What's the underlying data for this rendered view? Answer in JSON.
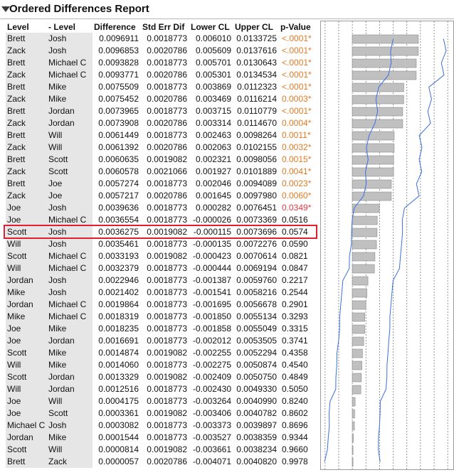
{
  "report": {
    "title": "Ordered Differences Report"
  },
  "columns": [
    "Level",
    "- Level",
    "Difference",
    "Std Err Dif",
    "Lower CL",
    "Upper CL",
    "p-Value"
  ],
  "colors": {
    "sig_orange": "#e07a22",
    "sig_red": "#e23a4c",
    "bar": "#c0c0c0",
    "ci_line": "#3a6fe0",
    "highlight": "#e02030"
  },
  "highlighted_row": 18,
  "rows": [
    {
      "level": "Brett",
      "minus": "Josh",
      "diff": "0.0096911",
      "se": "0.0018773",
      "lcl": "0.006010",
      "ucl": "0.0133725",
      "p": "<.0001*",
      "sig": "orange"
    },
    {
      "level": "Zack",
      "minus": "Josh",
      "diff": "0.0096853",
      "se": "0.0020786",
      "lcl": "0.005609",
      "ucl": "0.0137616",
      "p": "<.0001*",
      "sig": "orange"
    },
    {
      "level": "Brett",
      "minus": "Michael C",
      "diff": "0.0093828",
      "se": "0.0018773",
      "lcl": "0.005701",
      "ucl": "0.0130643",
      "p": "<.0001*",
      "sig": "orange"
    },
    {
      "level": "Zack",
      "minus": "Michael C",
      "diff": "0.0093771",
      "se": "0.0020786",
      "lcl": "0.005301",
      "ucl": "0.0134534",
      "p": "<.0001*",
      "sig": "orange"
    },
    {
      "level": "Brett",
      "minus": "Mike",
      "diff": "0.0075509",
      "se": "0.0018773",
      "lcl": "0.003869",
      "ucl": "0.0112323",
      "p": "<.0001*",
      "sig": "orange"
    },
    {
      "level": "Zack",
      "minus": "Mike",
      "diff": "0.0075452",
      "se": "0.0020786",
      "lcl": "0.003469",
      "ucl": "0.0116214",
      "p": "0.0003*",
      "sig": "orange"
    },
    {
      "level": "Brett",
      "minus": "Jordan",
      "diff": "0.0073965",
      "se": "0.0018773",
      "lcl": "0.003715",
      "ucl": "0.0110779",
      "p": "<.0001*",
      "sig": "orange"
    },
    {
      "level": "Zack",
      "minus": "Jordan",
      "diff": "0.0073908",
      "se": "0.0020786",
      "lcl": "0.003314",
      "ucl": "0.0114670",
      "p": "0.0004*",
      "sig": "orange"
    },
    {
      "level": "Brett",
      "minus": "Will",
      "diff": "0.0061449",
      "se": "0.0018773",
      "lcl": "0.002463",
      "ucl": "0.0098264",
      "p": "0.0011*",
      "sig": "orange"
    },
    {
      "level": "Zack",
      "minus": "Will",
      "diff": "0.0061392",
      "se": "0.0020786",
      "lcl": "0.002063",
      "ucl": "0.0102155",
      "p": "0.0032*",
      "sig": "orange"
    },
    {
      "level": "Brett",
      "minus": "Scott",
      "diff": "0.0060635",
      "se": "0.0019082",
      "lcl": "0.002321",
      "ucl": "0.0098056",
      "p": "0.0015*",
      "sig": "orange"
    },
    {
      "level": "Zack",
      "minus": "Scott",
      "diff": "0.0060578",
      "se": "0.0021066",
      "lcl": "0.001927",
      "ucl": "0.0101889",
      "p": "0.0041*",
      "sig": "orange"
    },
    {
      "level": "Brett",
      "minus": "Joe",
      "diff": "0.0057274",
      "se": "0.0018773",
      "lcl": "0.002046",
      "ucl": "0.0094089",
      "p": "0.0023*",
      "sig": "orange"
    },
    {
      "level": "Zack",
      "minus": "Joe",
      "diff": "0.0057217",
      "se": "0.0020786",
      "lcl": "0.001645",
      "ucl": "0.0097980",
      "p": "0.0060*",
      "sig": "orange"
    },
    {
      "level": "Joe",
      "minus": "Josh",
      "diff": "0.0039636",
      "se": "0.0018773",
      "lcl": "0.000282",
      "ucl": "0.0076451",
      "p": "0.0349*",
      "sig": "red"
    },
    {
      "level": "Joe",
      "minus": "Michael C",
      "diff": "0.0036554",
      "se": "0.0018773",
      "lcl": "-0.000026",
      "ucl": "0.0073369",
      "p": "0.0516",
      "sig": ""
    },
    {
      "level": "Scott",
      "minus": "Josh",
      "diff": "0.0036275",
      "se": "0.0019082",
      "lcl": "-0.000115",
      "ucl": "0.0073696",
      "p": "0.0574",
      "sig": ""
    },
    {
      "level": "Will",
      "minus": "Josh",
      "diff": "0.0035461",
      "se": "0.0018773",
      "lcl": "-0.000135",
      "ucl": "0.0072276",
      "p": "0.0590",
      "sig": ""
    },
    {
      "level": "Scott",
      "minus": "Michael C",
      "diff": "0.0033193",
      "se": "0.0019082",
      "lcl": "-0.000423",
      "ucl": "0.0070614",
      "p": "0.0821",
      "sig": ""
    },
    {
      "level": "Will",
      "minus": "Michael C",
      "diff": "0.0032379",
      "se": "0.0018773",
      "lcl": "-0.000444",
      "ucl": "0.0069194",
      "p": "0.0847",
      "sig": ""
    },
    {
      "level": "Jordan",
      "minus": "Josh",
      "diff": "0.0022946",
      "se": "0.0018773",
      "lcl": "-0.001387",
      "ucl": "0.0059760",
      "p": "0.2217",
      "sig": ""
    },
    {
      "level": "Mike",
      "minus": "Josh",
      "diff": "0.0021402",
      "se": "0.0018773",
      "lcl": "-0.001541",
      "ucl": "0.0058216",
      "p": "0.2544",
      "sig": ""
    },
    {
      "level": "Jordan",
      "minus": "Michael C",
      "diff": "0.0019864",
      "se": "0.0018773",
      "lcl": "-0.001695",
      "ucl": "0.0056678",
      "p": "0.2901",
      "sig": ""
    },
    {
      "level": "Mike",
      "minus": "Michael C",
      "diff": "0.0018319",
      "se": "0.0018773",
      "lcl": "-0.001850",
      "ucl": "0.0055134",
      "p": "0.3293",
      "sig": ""
    },
    {
      "level": "Joe",
      "minus": "Mike",
      "diff": "0.0018235",
      "se": "0.0018773",
      "lcl": "-0.001858",
      "ucl": "0.0055049",
      "p": "0.3315",
      "sig": ""
    },
    {
      "level": "Joe",
      "minus": "Jordan",
      "diff": "0.0016691",
      "se": "0.0018773",
      "lcl": "-0.002012",
      "ucl": "0.0053505",
      "p": "0.3741",
      "sig": ""
    },
    {
      "level": "Scott",
      "minus": "Mike",
      "diff": "0.0014874",
      "se": "0.0019082",
      "lcl": "-0.002255",
      "ucl": "0.0052294",
      "p": "0.4358",
      "sig": ""
    },
    {
      "level": "Will",
      "minus": "Mike",
      "diff": "0.0014060",
      "se": "0.0018773",
      "lcl": "-0.002275",
      "ucl": "0.0050874",
      "p": "0.4540",
      "sig": ""
    },
    {
      "level": "Scott",
      "minus": "Jordan",
      "diff": "0.0013329",
      "se": "0.0019082",
      "lcl": "-0.002409",
      "ucl": "0.0050750",
      "p": "0.4849",
      "sig": ""
    },
    {
      "level": "Will",
      "minus": "Jordan",
      "diff": "0.0012516",
      "se": "0.0018773",
      "lcl": "-0.002430",
      "ucl": "0.0049330",
      "p": "0.5050",
      "sig": ""
    },
    {
      "level": "Joe",
      "minus": "Will",
      "diff": "0.0004175",
      "se": "0.0018773",
      "lcl": "-0.003264",
      "ucl": "0.0040990",
      "p": "0.8240",
      "sig": ""
    },
    {
      "level": "Joe",
      "minus": "Scott",
      "diff": "0.0003361",
      "se": "0.0019082",
      "lcl": "-0.003406",
      "ucl": "0.0040782",
      "p": "0.8602",
      "sig": ""
    },
    {
      "level": "Michael C",
      "minus": "Josh",
      "diff": "0.0003082",
      "se": "0.0018773",
      "lcl": "-0.003373",
      "ucl": "0.0039897",
      "p": "0.8696",
      "sig": ""
    },
    {
      "level": "Jordan",
      "minus": "Mike",
      "diff": "0.0001544",
      "se": "0.0018773",
      "lcl": "-0.003527",
      "ucl": "0.0038359",
      "p": "0.9344",
      "sig": ""
    },
    {
      "level": "Scott",
      "minus": "Will",
      "diff": "0.0000814",
      "se": "0.0019082",
      "lcl": "-0.003661",
      "ucl": "0.0038234",
      "p": "0.9660",
      "sig": ""
    },
    {
      "level": "Brett",
      "minus": "Zack",
      "diff": "0.0000057",
      "se": "0.0020786",
      "lcl": "-0.004071",
      "ucl": "0.0040820",
      "p": "0.9978",
      "sig": ""
    }
  ]
}
